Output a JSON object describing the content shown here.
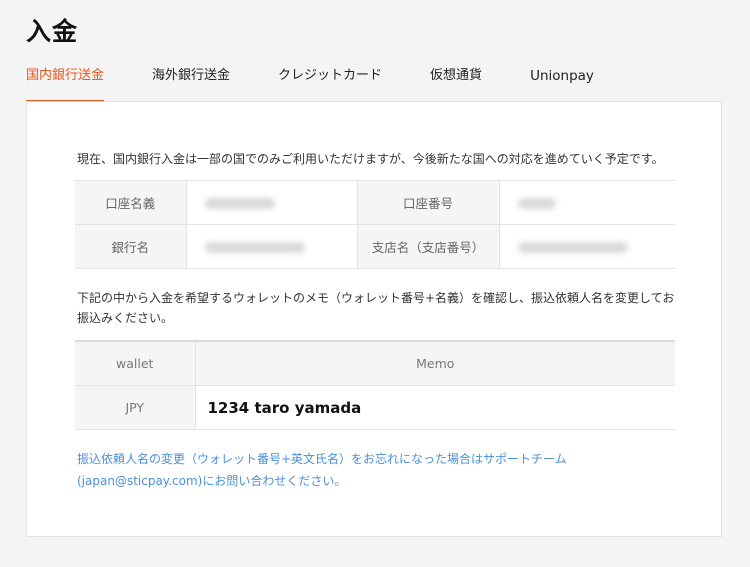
{
  "page": {
    "title": "入金"
  },
  "tabs": [
    {
      "label": "国内銀行送金",
      "active": true
    },
    {
      "label": "海外銀行送金",
      "active": false
    },
    {
      "label": "クレジットカード",
      "active": false
    },
    {
      "label": "仮想通貨",
      "active": false
    },
    {
      "label": "Unionpay",
      "active": false
    }
  ],
  "colors": {
    "accent": "#e8551f",
    "link": "#4a90d9"
  },
  "content": {
    "notice": "現在、国内銀行入金は一部の国でのみご利用いただけますが、今後新たな国への対応を進めていく予定です。",
    "bank_info": {
      "account_name_label": "口座名義",
      "account_number_label": "口座番号",
      "bank_name_label": "銀行名",
      "branch_label": "支店名（支店番号）"
    },
    "instruction": "下記の中から入金を希望するウォレットのメモ（ウォレット番号+名義）を確認し、振込依頼人名を変更してお振込みください。",
    "wallet_table": {
      "headers": {
        "wallet": "wallet",
        "memo": "Memo"
      },
      "rows": [
        {
          "wallet": "JPY",
          "memo": "1234 taro yamada"
        }
      ]
    },
    "help_text": "振込依頼人名の変更（ウォレット番号+英文氏名）をお忘れになった場合はサポートチーム(japan@sticpay.com)にお問い合わせください。"
  }
}
